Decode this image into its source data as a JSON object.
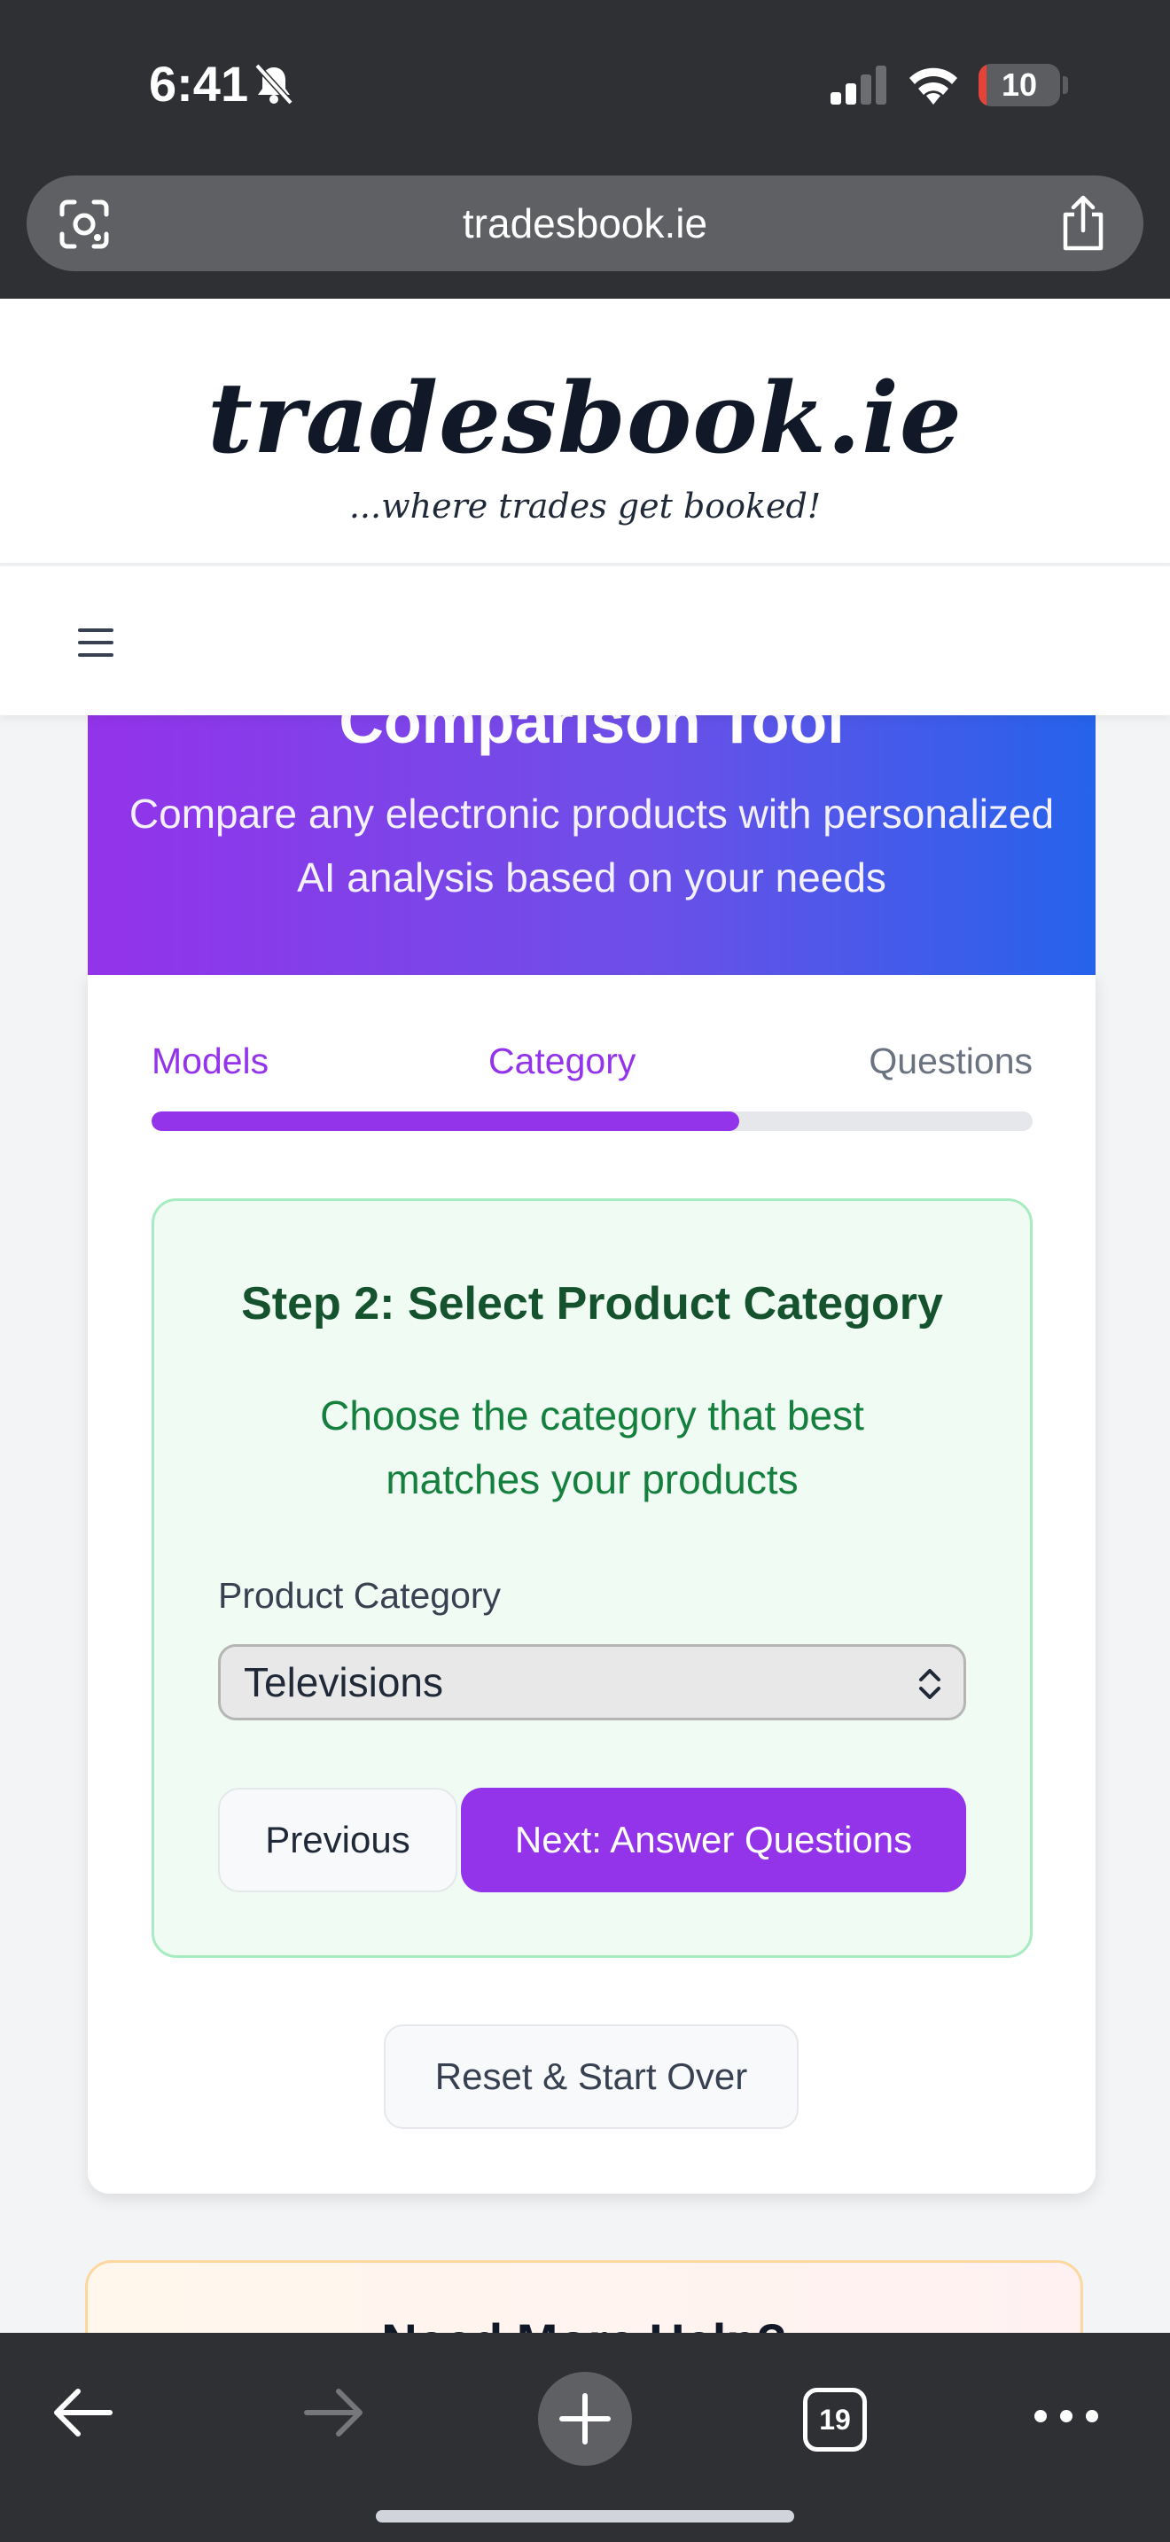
{
  "status_bar": {
    "time": "6:41",
    "battery": "10",
    "battery_level": 0.1
  },
  "browser": {
    "url": "tradesbook.ie",
    "tab_count": "19"
  },
  "site": {
    "logo": "tradesbook.ie",
    "tagline": "...where trades get booked!"
  },
  "hero": {
    "title": "Comparison Tool",
    "subtitle": "Compare any electronic products with personalized AI analysis based on your needs"
  },
  "steps": {
    "items": [
      "Models",
      "Category",
      "Questions"
    ],
    "progress": 0.667
  },
  "step_box": {
    "title": "Step 2: Select Product Category",
    "description": "Choose the category that best matches your products",
    "field_label": "Product Category",
    "selected_category": "Televisions",
    "previous_label": "Previous",
    "next_label": "Next: Answer Questions"
  },
  "reset_label": "Reset & Start Over",
  "help": {
    "title": "Need More Help?"
  },
  "colors": {
    "accent": "#9333ea",
    "hero_end": "#2563eb",
    "success_bg": "#effbf3",
    "success_text": "#15803d"
  }
}
